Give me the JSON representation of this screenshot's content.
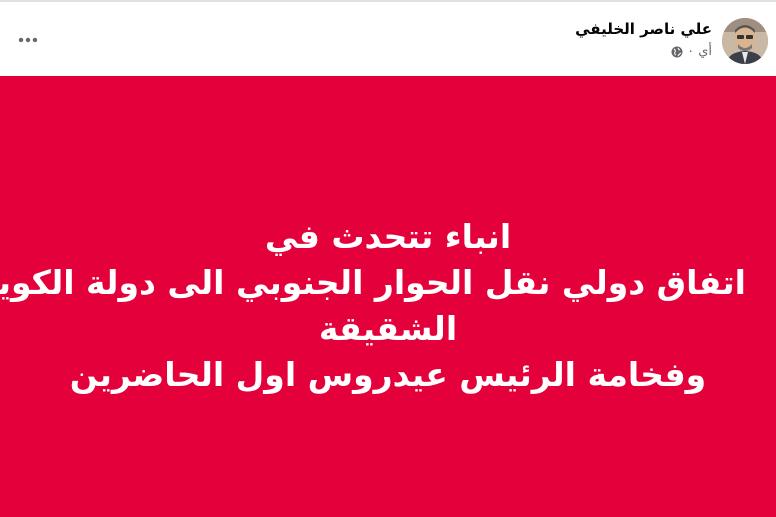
{
  "post": {
    "author": "علي ناصر الخليفي",
    "time": "أي ٠",
    "privacy_icon": "globe-icon",
    "more_icon": "more-horizontal-icon"
  },
  "banner": {
    "background": "#e4003a",
    "text_color": "#ffffff",
    "lines": [
      "انباء تتحدث في",
      "اتفاق دولي نقل الحوار الجنوبي الى دولة الكويت",
      "الشقيقة",
      "وفخامة الرئيس عيدروس اول الحاضرين"
    ]
  }
}
